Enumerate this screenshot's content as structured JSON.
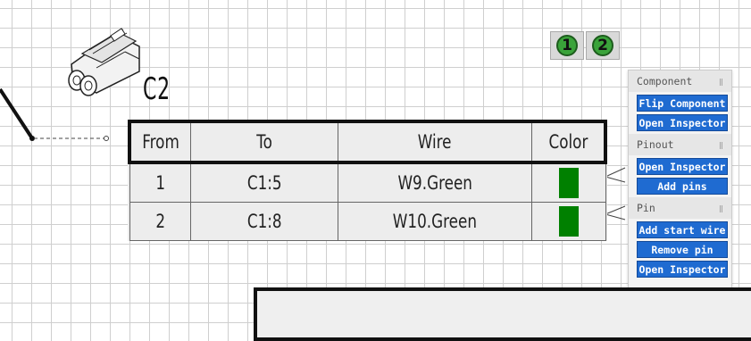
{
  "connector": {
    "label": "C2"
  },
  "toggles": [
    {
      "label": "1"
    },
    {
      "label": "2"
    }
  ],
  "table": {
    "headers": [
      "From",
      "To",
      "Wire",
      "Color"
    ],
    "rows": [
      {
        "from": "1",
        "to": "C1:5",
        "wire": "W9.Green",
        "color": "#008000"
      },
      {
        "from": "2",
        "to": "C1:8",
        "wire": "W10.Green",
        "color": "#008000"
      }
    ]
  },
  "panel": {
    "sections": [
      {
        "title": "Component",
        "buttons": [
          "Flip Component",
          "Open Inspector"
        ]
      },
      {
        "title": "Pinout",
        "buttons": [
          "Open Inspector",
          "Add pins"
        ]
      },
      {
        "title": "Pin",
        "buttons": [
          "Add start wire",
          "Remove pin",
          "Open Inspector"
        ]
      }
    ]
  },
  "colors": {
    "panel_button": "#1f6bd1",
    "toggle_green": "#3aa33a",
    "grid": "#cfcfcf"
  }
}
